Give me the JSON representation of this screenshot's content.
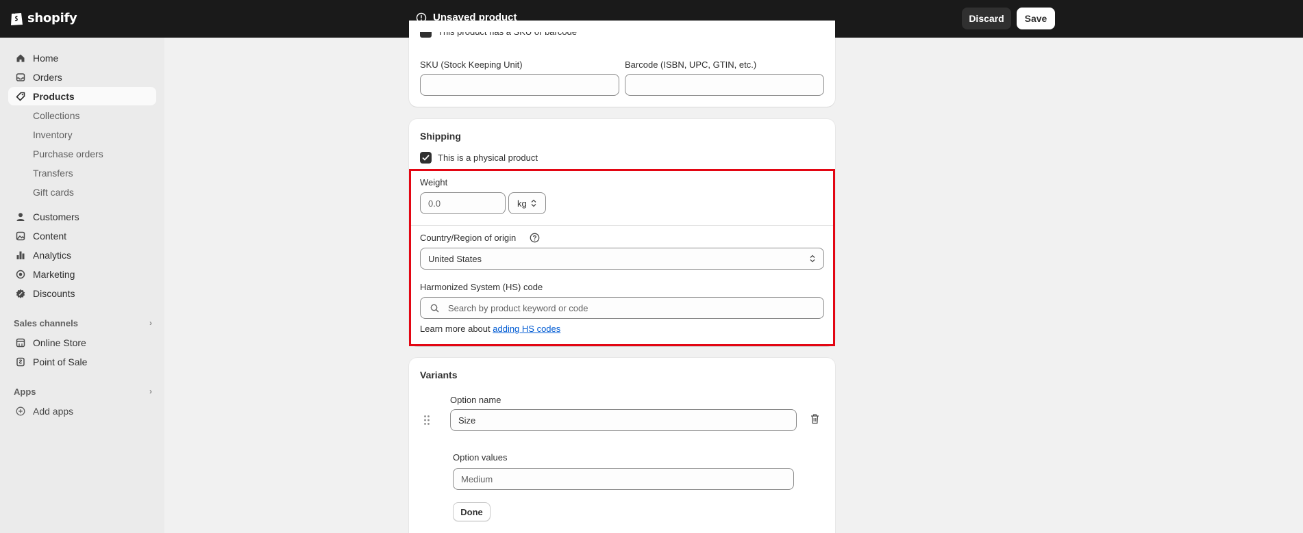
{
  "topbar": {
    "logo_text": "shopify",
    "title": "Unsaved product",
    "discard_label": "Discard",
    "save_label": "Save"
  },
  "sidebar": {
    "items": [
      {
        "label": "Home",
        "icon": "home-icon"
      },
      {
        "label": "Orders",
        "icon": "inbox-icon"
      },
      {
        "label": "Products",
        "icon": "tag-icon",
        "active": true
      },
      {
        "label": "Customers",
        "icon": "person-icon"
      },
      {
        "label": "Content",
        "icon": "image-icon"
      },
      {
        "label": "Analytics",
        "icon": "bar-chart-icon"
      },
      {
        "label": "Marketing",
        "icon": "target-icon"
      },
      {
        "label": "Discounts",
        "icon": "discount-icon"
      }
    ],
    "product_subitems": [
      "Collections",
      "Inventory",
      "Purchase orders",
      "Transfers",
      "Gift cards"
    ],
    "sales_channels": {
      "heading": "Sales channels",
      "items": [
        {
          "label": "Online Store",
          "icon": "store-icon"
        },
        {
          "label": "Point of Sale",
          "icon": "pos-icon"
        }
      ]
    },
    "apps": {
      "heading": "Apps",
      "add_label": "Add apps"
    }
  },
  "inventory_card": {
    "sku_checkbox_label": "This product has a SKU or barcode",
    "sku_label": "SKU (Stock Keeping Unit)",
    "sku_value": "",
    "barcode_label": "Barcode (ISBN, UPC, GTIN, etc.)",
    "barcode_value": ""
  },
  "shipping_card": {
    "title": "Shipping",
    "physical_label": "This is a physical product",
    "weight_label": "Weight",
    "weight_value": "0.0",
    "weight_unit": "kg",
    "country_label": "Country/Region of origin",
    "country_value": "United States",
    "hs_label": "Harmonized System (HS) code",
    "hs_placeholder": "Search by product keyword or code",
    "learn_more_text": "Learn more about",
    "learn_more_link": "adding HS codes"
  },
  "variants_card": {
    "title": "Variants",
    "option_name_label": "Option name",
    "option_name_value": "Size",
    "option_values_label": "Option values",
    "option_value": "Medium",
    "done_label": "Done"
  },
  "colors": {
    "topbar_bg": "#1a1a1a",
    "highlight_border": "#e30613",
    "link": "#005bd3"
  }
}
